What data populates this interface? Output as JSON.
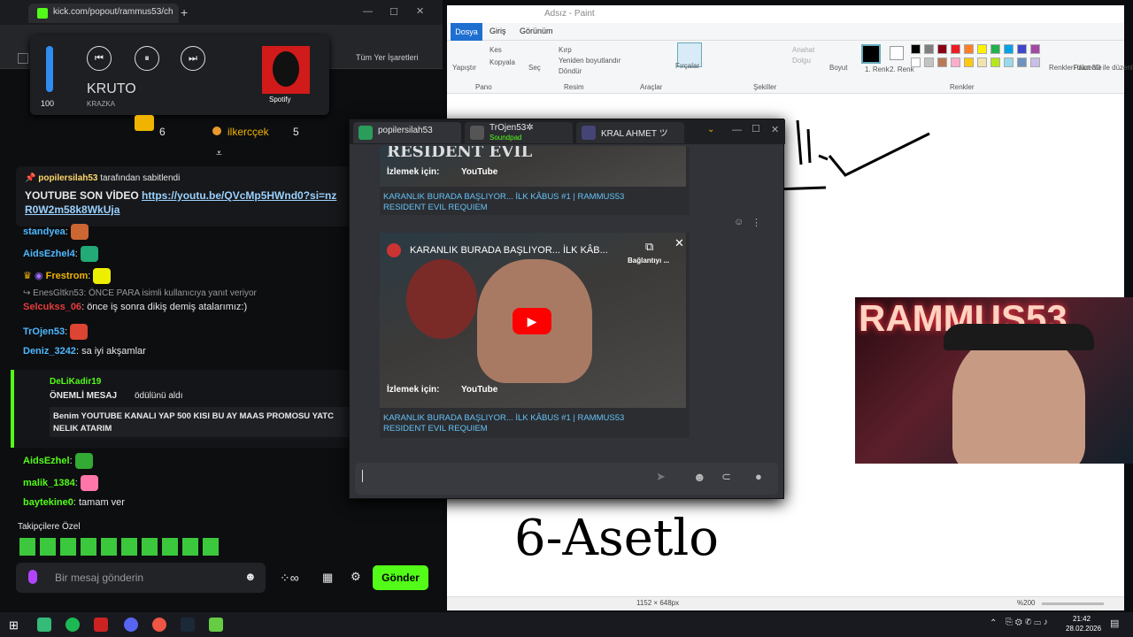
{
  "browser": {
    "tab_title": "kick.com/popout/rammus53/ch",
    "new_tab": "+",
    "bookmarks_label": "Tüm Yer İşaretleri"
  },
  "media": {
    "volume": "100",
    "volume_fraction": 1.0,
    "track": "KRUTO",
    "artist": "KRAZKA",
    "source": "Spotify",
    "prev": "⏮",
    "pause": "⏸",
    "next": "⏭"
  },
  "leaderboard": [
    {
      "name": "ilkercçek",
      "count": "5"
    },
    {
      "name": "",
      "count": "6"
    }
  ],
  "pinned": {
    "pinned_by": "popilersilah53",
    "pinned_suffix": "tarafından sabitlendi",
    "text": "YOUTUBE SON VİDEO",
    "link": "https://youtu.be/QVcMp5HWnd0?si=nzR0W2m58k8WkUja"
  },
  "chat": [
    {
      "user": "standyea",
      "text": ""
    },
    {
      "user": "AidsEzhel4",
      "text": ""
    },
    {
      "user": "Frestrom",
      "text": ""
    },
    {
      "user": "EnesGltkn53",
      "reply": "ÖNCE PARA isimli kullanıcıya yanıt veriyor"
    },
    {
      "user": "Selcukss_06",
      "text": "önce iş sonra dikiş demiş atalarımız:)"
    },
    {
      "user": "TrOjen53",
      "text": ""
    },
    {
      "user": "Deniz_3242",
      "text": "sa iyi akşamlar"
    },
    {
      "user": "AidsEzhel",
      "text": ""
    },
    {
      "user": "malik_1384",
      "text": ""
    },
    {
      "user": "baytekine0",
      "text": "tamam ver"
    }
  ],
  "reward": {
    "user": "DeLiKadir19",
    "title": "ÖNEMLİ MESAJ",
    "suffix": "ödülünü aldı",
    "message": "Benim YOUTUBE KANALI YAP 500 KISI BU AY MAAS PROMOSU YATC",
    "message2": "NELIK ATARIM"
  },
  "chat_footer": {
    "followers_only": "Takipçilere Özel",
    "placeholder": "Bir mesaj gönderin",
    "send": "Gönder"
  },
  "paint": {
    "title": "Adsız - Paint",
    "menu": [
      "Dosya",
      "Giriş",
      "Görünüm"
    ],
    "groups": [
      "Pano",
      "Resim",
      "Araçlar",
      "Şekiller",
      "Renkler"
    ],
    "tools": {
      "paste": "Yapıştır",
      "cut": "Kes",
      "copy": "Kopyala",
      "select": "Seç",
      "crop": "Kırp",
      "resize": "Yeniden boyutlandır",
      "rotate": "Döndür",
      "brushes": "Fırçalar",
      "outline": "Anahat",
      "fill": "Dolgu",
      "size": "Boyut",
      "color1": "1. Renk",
      "color2": "2. Renk",
      "edit_colors": "Renkleri düzenle",
      "paint3d": "Paint 3D ile düzenle"
    },
    "palette": [
      "#000000",
      "#7f7f7f",
      "#880015",
      "#ed1c24",
      "#ff7f27",
      "#fff200",
      "#22b14c",
      "#00a2e8",
      "#3f48cc",
      "#a349a4",
      "#ffffff",
      "#c3c3c3",
      "#b97a57",
      "#ffaec9",
      "#ffc90e",
      "#efe4b0",
      "#b5e61d",
      "#99d9ea",
      "#7092be",
      "#c8bfe7"
    ],
    "canvas_text": "6-Asetlo",
    "canvas_size": "1152 × 648px",
    "zoom": "%200"
  },
  "discord": {
    "tabs": [
      {
        "name": "popilersilah53",
        "sub": ""
      },
      {
        "name": "TrOjen53✲",
        "sub": "Soundpad"
      },
      {
        "name": "KRAL AHMET ツ",
        "sub": ""
      }
    ],
    "embed_title": "KARANLIK BURADA BAŞLIYOR... İLK KÂBUS #1 | RAMMUS53",
    "embed_title2": "RESIDENT EVIL REQUIEM",
    "video_title": "KARANLIK BURADA BAŞLIYOR... İLK KÂB...",
    "connecting": "Bağlantıyı ...",
    "watch_on": "İzlemek için:",
    "youtube": "YouTube",
    "game_label": "RESIDENT EVIL"
  },
  "webcam": {
    "neon_text": "RAMMUS53"
  },
  "taskbar": {
    "time": "21:42",
    "date": "28.02.2026"
  }
}
